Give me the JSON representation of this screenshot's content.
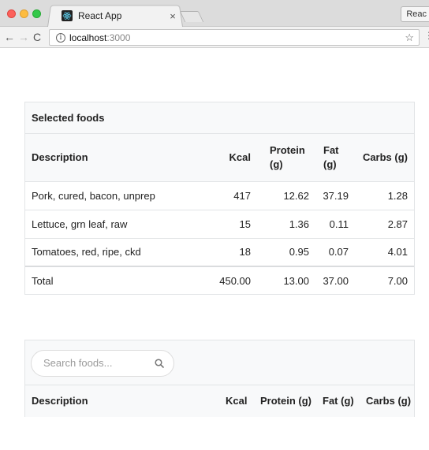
{
  "browser": {
    "tab_title": "React App",
    "tab_close": "×",
    "profile_label": "Reac",
    "url_host": "localhost",
    "url_port": ":3000",
    "info_glyph": "i"
  },
  "selected_foods": {
    "title": "Selected foods",
    "columns": [
      "Description",
      "Kcal",
      "Protein (g)",
      "Fat (g)",
      "Carbs (g)"
    ],
    "rows": [
      {
        "description": "Pork, cured, bacon, unprep",
        "kcal": "417",
        "protein": "12.62",
        "fat": "37.19",
        "carbs": "1.28"
      },
      {
        "description": "Lettuce, grn leaf, raw",
        "kcal": "15",
        "protein": "1.36",
        "fat": "0.11",
        "carbs": "2.87"
      },
      {
        "description": "Tomatoes, red, ripe, ckd",
        "kcal": "18",
        "protein": "0.95",
        "fat": "0.07",
        "carbs": "4.01"
      }
    ],
    "total": {
      "description": "Total",
      "kcal": "450.00",
      "protein": "13.00",
      "fat": "37.00",
      "carbs": "7.00"
    }
  },
  "search": {
    "placeholder": "Search foods...",
    "value": "",
    "columns": [
      "Description",
      "Kcal",
      "Protein (g)",
      "Fat (g)",
      "Carbs (g)"
    ]
  },
  "icons": {
    "back": "arrow-left-icon",
    "forward": "arrow-right-icon",
    "reload": "reload-icon",
    "info": "info-icon",
    "star": "star-icon",
    "search": "search-icon",
    "favicon": "react-logo-icon"
  },
  "colors": {
    "traffic_red": "#fc605b",
    "traffic_yellow": "#fdbc40",
    "traffic_green": "#34c84a",
    "header_bg": "#f8f9fa",
    "border": "#e2e4e6"
  }
}
